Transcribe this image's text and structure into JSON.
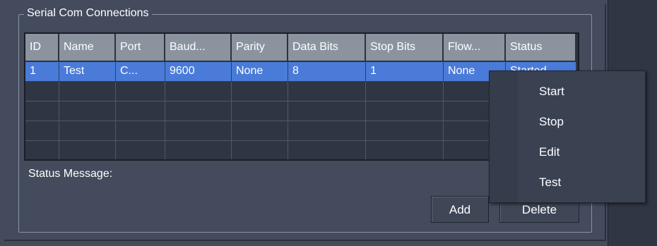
{
  "group": {
    "title": "Serial Com Connections"
  },
  "table": {
    "columns": [
      "ID",
      "Name",
      "Port",
      "Baud...",
      "Parity",
      "Data Bits",
      "Stop Bits",
      "Flow...",
      "Status"
    ],
    "rows": [
      [
        "1",
        "Test",
        "C...",
        "9600",
        "None",
        "8",
        "1",
        "None",
        "Started"
      ]
    ]
  },
  "status": {
    "label": "Status Message:"
  },
  "buttons": {
    "add": "Add",
    "delete": "Delete"
  },
  "context_menu": {
    "items": [
      "Start",
      "Stop",
      "Edit",
      "Test"
    ]
  },
  "colors": {
    "selection": "#4a7bd9",
    "header": "#8b939f",
    "background": "#434b5c"
  }
}
